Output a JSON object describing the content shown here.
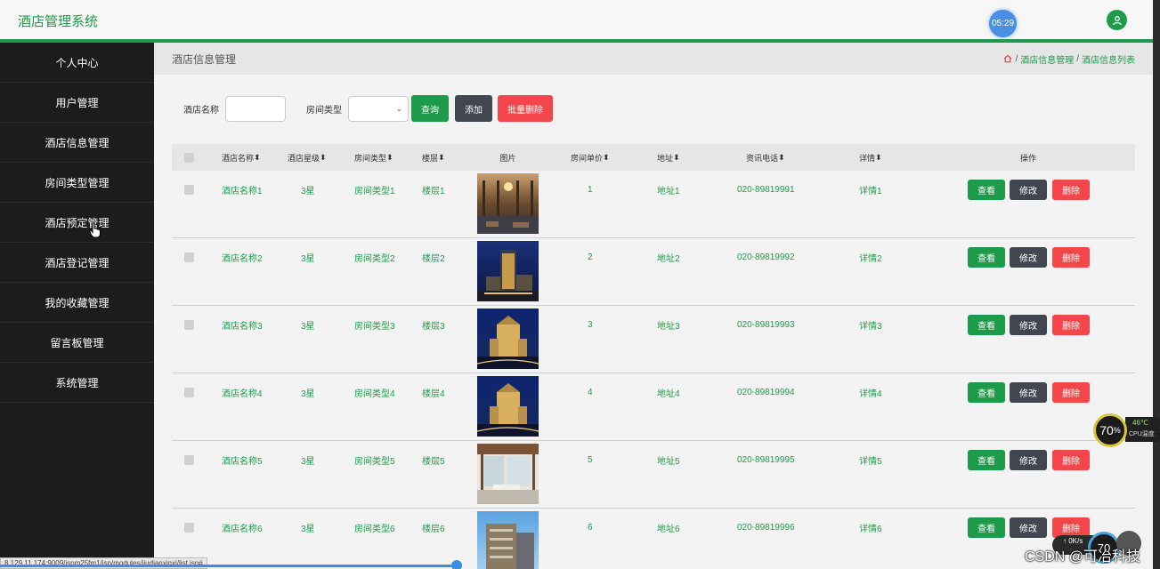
{
  "app": {
    "title": "酒店管理系统",
    "clock": "05:29"
  },
  "sidebar": {
    "items": [
      {
        "label": "个人中心"
      },
      {
        "label": "用户管理"
      },
      {
        "label": "酒店信息管理"
      },
      {
        "label": "房间类型管理"
      },
      {
        "label": "酒店预定管理"
      },
      {
        "label": "酒店登记管理"
      },
      {
        "label": "我的收藏管理"
      },
      {
        "label": "留言板管理"
      },
      {
        "label": "系统管理"
      }
    ]
  },
  "page": {
    "title": "酒店信息管理",
    "breadcrumb": [
      "酒店信息管理",
      "酒店信息列表"
    ],
    "breadcrumb_sep": "/"
  },
  "search": {
    "name_label": "酒店名称",
    "name_value": "",
    "type_label": "房间类型",
    "type_value": "",
    "query_button": "查询",
    "add_button": "添加",
    "batch_delete_button": "批量删除"
  },
  "colors": {
    "primary": "#1e9b4a",
    "dark": "#414651",
    "danger": "#f2464b"
  },
  "table": {
    "headers": [
      "酒店名称",
      "酒店星级",
      "房间类型",
      "楼层",
      "图片",
      "房间单价",
      "地址",
      "资讯电话",
      "详情",
      "操作"
    ],
    "action_labels": {
      "view": "查看",
      "edit": "修改",
      "delete": "删除"
    },
    "rows": [
      {
        "name": "酒店名称1",
        "star": "3星",
        "type": "房间类型1",
        "floor": "楼层1",
        "price": "1",
        "address": "地址1",
        "phone": "020-89819991",
        "detail": "详情1",
        "image": "lobby"
      },
      {
        "name": "酒店名称2",
        "star": "3星",
        "type": "房间类型2",
        "floor": "楼层2",
        "price": "2",
        "address": "地址2",
        "phone": "020-89819992",
        "detail": "详情2",
        "image": "tower-night"
      },
      {
        "name": "酒店名称3",
        "star": "3星",
        "type": "房间类型3",
        "floor": "楼层3",
        "price": "3",
        "address": "地址3",
        "phone": "020-89819993",
        "detail": "详情3",
        "image": "palace-night"
      },
      {
        "name": "酒店名称4",
        "star": "3星",
        "type": "房间类型4",
        "floor": "楼层4",
        "price": "4",
        "address": "地址4",
        "phone": "020-89819994",
        "detail": "详情4",
        "image": "palace-night"
      },
      {
        "name": "酒店名称5",
        "star": "3星",
        "type": "房间类型5",
        "floor": "楼层5",
        "price": "5",
        "address": "地址5",
        "phone": "020-89819995",
        "detail": "详情5",
        "image": "room-interior"
      },
      {
        "name": "酒店名称6",
        "star": "3星",
        "type": "房间类型6",
        "floor": "楼层6",
        "price": "6",
        "address": "地址6",
        "phone": "020-89819996",
        "detail": "详情6",
        "image": "building-day"
      }
    ]
  },
  "status_bar": {
    "url": "8.129.11.174:9009/jspm25fm1/jsp/modules/jiudianxinxi/list.jsp#"
  },
  "overlay": {
    "cpu_percent": "70",
    "cpu_unit": "%",
    "cpu_temp": "46℃",
    "cpu_label": "CPU温度",
    "net_speed": "0K/s",
    "net_percent": "70",
    "watermark": "CSDN @可冶科技"
  }
}
